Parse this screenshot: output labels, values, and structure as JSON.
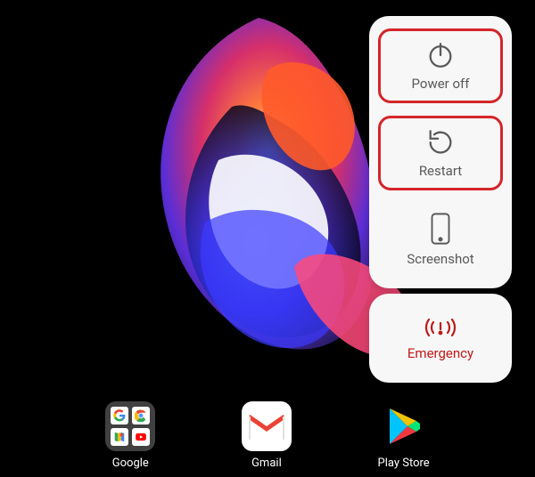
{
  "dock": {
    "items": [
      {
        "label": "Google",
        "type": "folder"
      },
      {
        "label": "Gmail",
        "type": "app"
      },
      {
        "label": "Play Store",
        "type": "app"
      }
    ]
  },
  "powerMenu": {
    "items": [
      {
        "label": "Power off",
        "highlighted": true
      },
      {
        "label": "Restart",
        "highlighted": true
      },
      {
        "label": "Screenshot",
        "highlighted": false
      }
    ],
    "emergency": {
      "label": "Emergency"
    }
  },
  "colors": {
    "highlight": "#d4252a",
    "emergency": "#c01818",
    "menuBg": "#f7f7f7",
    "menuText": "#595959"
  }
}
